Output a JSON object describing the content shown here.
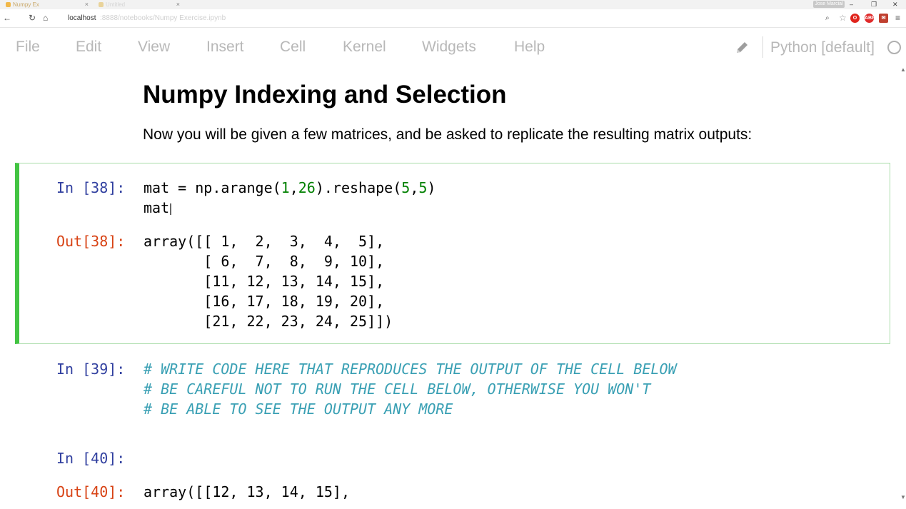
{
  "browser": {
    "tabs": [
      {
        "label": "Numpy Ex"
      },
      {
        "label": "Untitled"
      }
    ],
    "user_badge": "Jose Marcial",
    "url_host": "localhost",
    "url_path": ":8888/notebooks/Numpy Exercise.ipynb",
    "extensions": [
      {
        "icon": "opera-icon",
        "color": "#e0241c"
      },
      {
        "icon": "adblock-icon",
        "label": "ABP",
        "color": "#e02a2a"
      },
      {
        "icon": "gmail-icon",
        "color": "#c04030"
      }
    ]
  },
  "menu": {
    "items": [
      "File",
      "Edit",
      "View",
      "Insert",
      "Cell",
      "Kernel",
      "Widgets",
      "Help"
    ],
    "kernel_name": "Python [default]"
  },
  "notebook": {
    "heading": "Numpy Indexing and Selection",
    "paragraph": "Now you will be given a few matrices, and be asked to replicate the resulting matrix outputs:",
    "cell38": {
      "in_prompt": "In [38]:",
      "code_line1": {
        "a": "mat = np.arange(",
        "n1": "1",
        "c": ",",
        "n2": "26",
        "b": ").reshape(",
        "n3": "5",
        "d": ",",
        "n4": "5",
        "e": ")"
      },
      "code_line2": "mat",
      "out_prompt": "Out[38]:",
      "output_lines": [
        "array([[ 1,  2,  3,  4,  5],",
        "       [ 6,  7,  8,  9, 10],",
        "       [11, 12, 13, 14, 15],",
        "       [16, 17, 18, 19, 20],",
        "       [21, 22, 23, 24, 25]])"
      ]
    },
    "cell39": {
      "in_prompt": "In [39]:",
      "comment_lines": [
        "# WRITE CODE HERE THAT REPRODUCES THE OUTPUT OF THE CELL BELOW",
        "# BE CAREFUL NOT TO RUN THE CELL BELOW, OTHERWISE YOU WON'T",
        "# BE ABLE TO SEE THE OUTPUT ANY MORE"
      ]
    },
    "cell40": {
      "in_prompt": "In [40]:",
      "out_prompt": "Out[40]:",
      "output_line": "array([[12, 13, 14, 15],"
    }
  },
  "colors": {
    "selected_cell_bar": "#42c442",
    "in_prompt": "#303f9f",
    "out_prompt": "#d84315",
    "comment": "#3aa0b4",
    "number": "#008000",
    "menu_text": "#b8b8b8"
  }
}
